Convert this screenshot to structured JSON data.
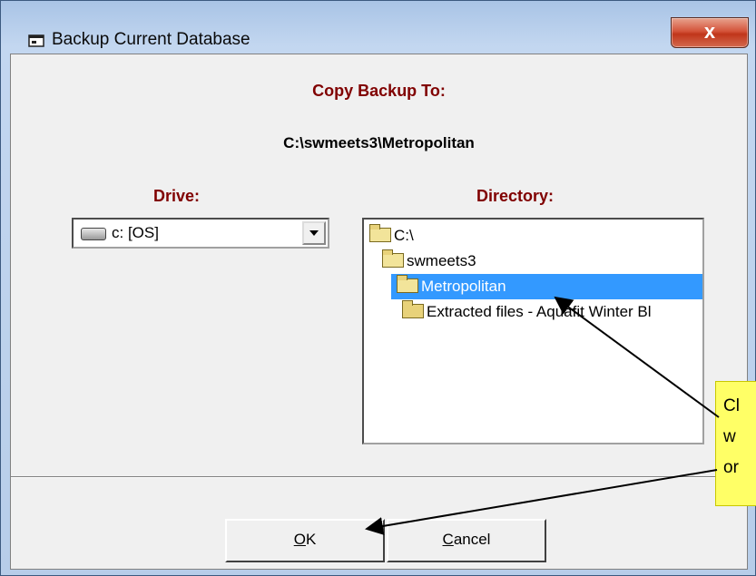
{
  "window": {
    "title": "Backup Current Database",
    "close_glyph": "x"
  },
  "dialog": {
    "heading": "Copy Backup To:",
    "current_path": "C:\\swmeets3\\Metropolitan",
    "drive_label": "Drive:",
    "directory_label": "Directory:",
    "drive_value": "c: [OS]",
    "directories": [
      {
        "label": "C:\\",
        "icon": "open-folder-icon",
        "selected": false
      },
      {
        "label": "swmeets3",
        "icon": "open-folder-icon",
        "selected": false
      },
      {
        "label": "Metropolitan",
        "icon": "open-folder-icon",
        "selected": true
      },
      {
        "label": "Extracted files - Aquafit Winter Bl",
        "icon": "folder-icon",
        "selected": false
      }
    ],
    "ok_label_underlined": "O",
    "ok_label_rest": "K",
    "cancel_label_underlined": "C",
    "cancel_label_rest": "ancel"
  },
  "callout": {
    "lines": [
      "Cl",
      "w",
      "or"
    ]
  },
  "colors": {
    "label_accent": "#800000",
    "selection": "#3399ff",
    "callout_bg": "#ffff66"
  }
}
